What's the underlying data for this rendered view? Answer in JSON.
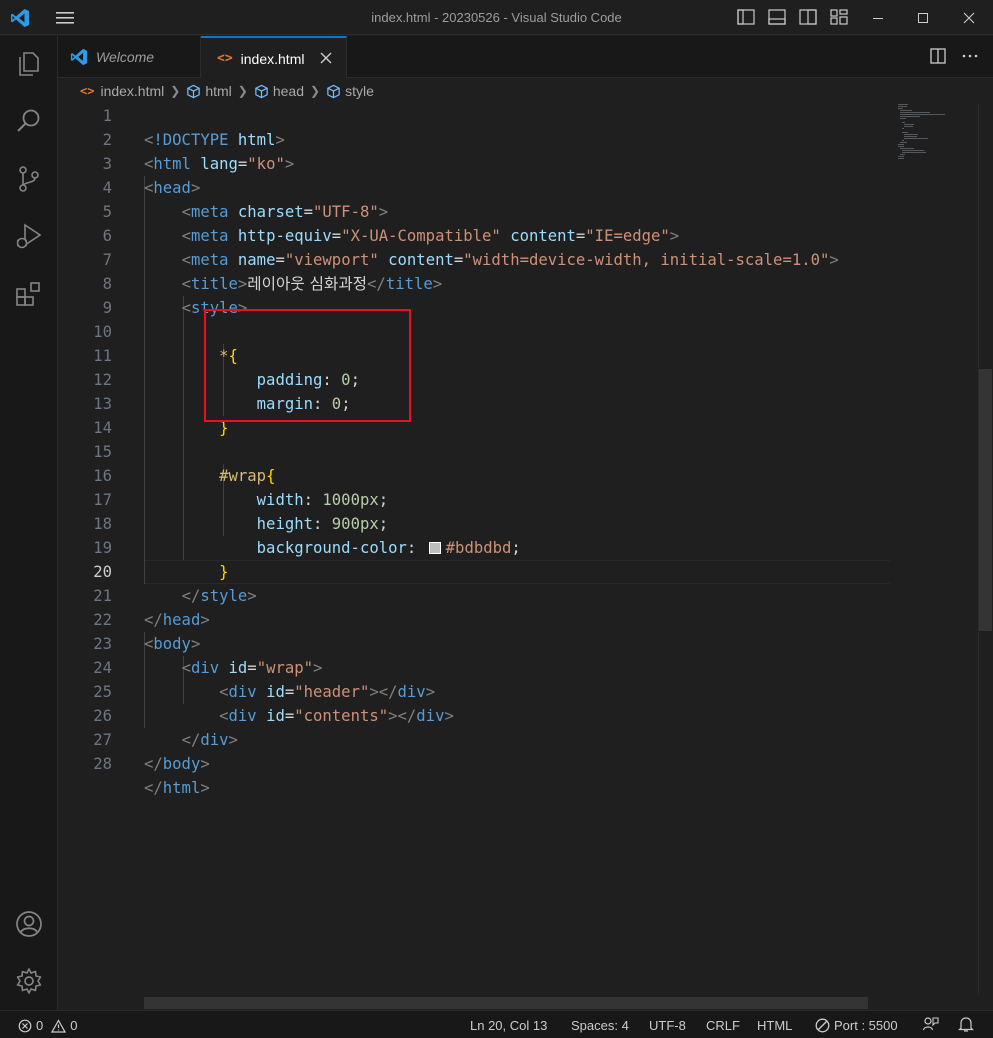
{
  "window": {
    "title": "index.html - 20230526 - Visual Studio Code",
    "controls": [
      "minimize",
      "maximize",
      "close"
    ]
  },
  "tabs": [
    {
      "label": "Welcome",
      "icon": "vscode-logo-icon",
      "active": false
    },
    {
      "label": "index.html",
      "icon": "html-file-icon",
      "active": true
    }
  ],
  "breadcrumb": [
    "index.html",
    "html",
    "head",
    "style"
  ],
  "editor": {
    "active_line": 20,
    "lines": [
      {
        "n": "1"
      },
      {
        "n": "2"
      },
      {
        "n": "3"
      },
      {
        "n": "4"
      },
      {
        "n": "5"
      },
      {
        "n": "6"
      },
      {
        "n": "7"
      },
      {
        "n": "8"
      },
      {
        "n": "9"
      },
      {
        "n": "10"
      },
      {
        "n": "11"
      },
      {
        "n": "12"
      },
      {
        "n": "13"
      },
      {
        "n": "14"
      },
      {
        "n": "15"
      },
      {
        "n": "16"
      },
      {
        "n": "17"
      },
      {
        "n": "18"
      },
      {
        "n": "19"
      },
      {
        "n": "20"
      },
      {
        "n": "21"
      },
      {
        "n": "22"
      },
      {
        "n": "23"
      },
      {
        "n": "24"
      },
      {
        "n": "25"
      },
      {
        "n": "26"
      },
      {
        "n": "27"
      },
      {
        "n": "28"
      }
    ],
    "code": {
      "l1_doctype": "!DOCTYPE",
      "l1_html": "html",
      "l2_tag": "html",
      "l2_attr": "lang",
      "l2_val": "\"ko\"",
      "l3_tag": "head",
      "l4_tag": "meta",
      "l4_attr": "charset",
      "l4_val": "\"UTF-8\"",
      "l5_tag": "meta",
      "l5_attr1": "http-equiv",
      "l5_val1": "\"X-UA-Compatible\"",
      "l5_attr2": "content",
      "l5_val2": "\"IE=edge\"",
      "l6_tag": "meta",
      "l6_attr1": "name",
      "l6_val1": "\"viewport\"",
      "l6_attr2": "content",
      "l6_val2": "\"width=device-width, initial-scale=1.0\"",
      "l7_tag": "title",
      "l7_text": "레이아웃 심화과정",
      "l7_close": "title",
      "l8_tag": "style",
      "l10_sel": "*",
      "l11_prop": "padding",
      "l11_val": "0",
      "l12_prop": "margin",
      "l12_val": "0",
      "l15_sel": "#wrap",
      "l16_prop": "width",
      "l16_val": "1000px",
      "l17_prop": "height",
      "l17_val": "900px",
      "l18_prop": "background-color",
      "l18_val": "#bdbdbd",
      "l20_tag": "style",
      "l21_tag": "head",
      "l22_tag": "body",
      "l23_tag": "div",
      "l23_attr": "id",
      "l23_val": "\"wrap\"",
      "l24_tag": "div",
      "l24_attr": "id",
      "l24_val": "\"header\"",
      "l24_close": "div",
      "l25_tag": "div",
      "l25_attr": "id",
      "l25_val": "\"contents\"",
      "l25_close": "div",
      "l26_tag": "div",
      "l27_tag": "body",
      "l28_tag": "html"
    },
    "swatch_color": "#bdbdbd",
    "highlight_color": "#e81123"
  },
  "statusbar": {
    "errors": "0",
    "warnings": "0",
    "position": "Ln 20, Col 13",
    "spaces": "Spaces: 4",
    "encoding": "UTF-8",
    "eol": "CRLF",
    "language": "HTML",
    "port": "Port : 5500"
  },
  "colors": {
    "accent": "#0078d4",
    "background": "#1f1f1f",
    "tag": "#569cd6",
    "attribute": "#9cdcfe",
    "string": "#ce9178",
    "number": "#b5cea8",
    "selector": "#d7ba7d"
  }
}
